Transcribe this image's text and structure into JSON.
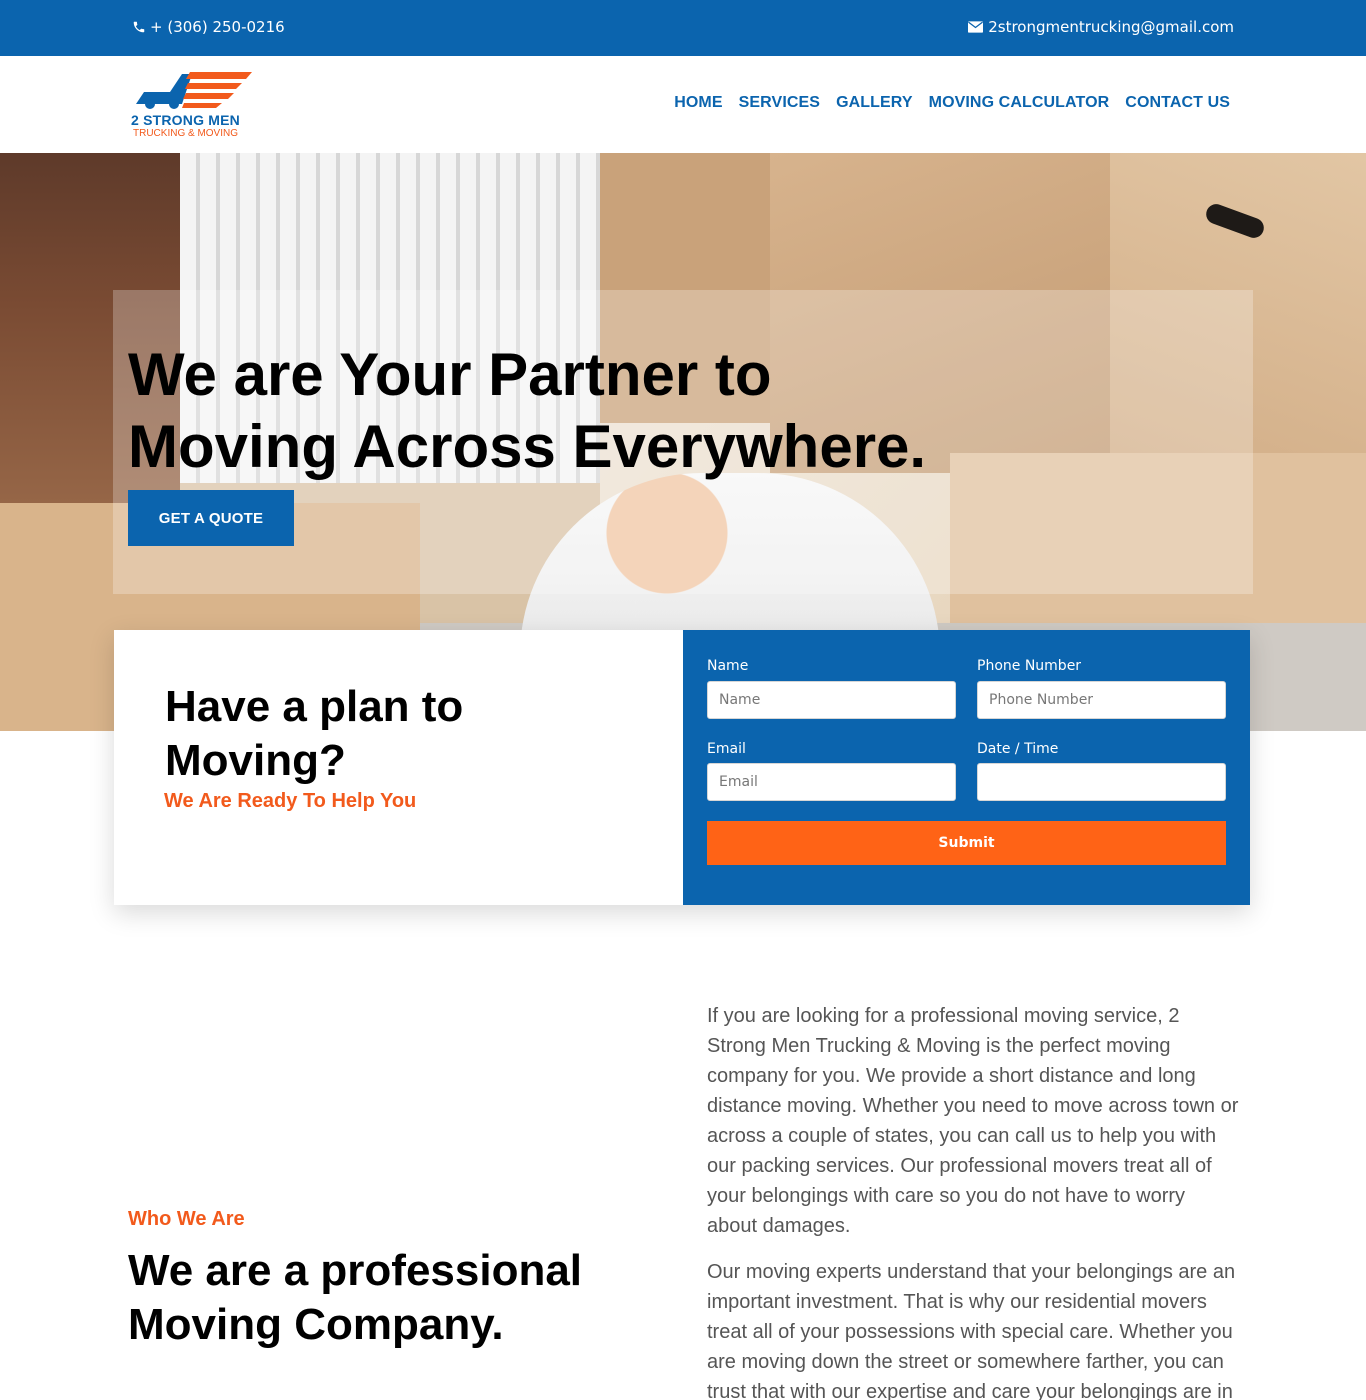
{
  "topbar": {
    "phone": "+ (306) 250-0216",
    "email": "2strongmentrucking@gmail.com"
  },
  "logo": {
    "line1": "2 STRONG MEN",
    "line2": "TRUCKING & MOVING"
  },
  "nav": [
    "HOME",
    "SERVICES",
    "GALLERY",
    "MOVING CALCULATOR",
    "CONTACT US"
  ],
  "hero": {
    "title_line1": "We are Your Partner to",
    "title_line2": "Moving Across Everywhere.",
    "cta": "GET A QUOTE"
  },
  "plan": {
    "title_line1": "Have a plan to",
    "title_line2": "Moving?",
    "subtitle": "We Are Ready To Help You"
  },
  "form": {
    "name_label": "Name",
    "name_placeholder": "Name",
    "phone_label": "Phone Number",
    "phone_placeholder": "Phone Number",
    "email_label": "Email",
    "email_placeholder": "Email",
    "date_label": "Date / Time",
    "date_value": "",
    "submit": "Submit"
  },
  "about": {
    "kicker": "Who We Are",
    "title_line1": "We are a professional",
    "title_line2": "Moving Company.",
    "paragraph1": "If you are looking for a professional moving service, 2 Strong Men Trucking & Moving is the perfect moving company for you. We provide a short distance and long distance moving. Whether you need to move across town or across a couple of states, you can call us to help you with our packing services. Our professional movers treat all of your belongings with care so you do not have to worry about damages.",
    "paragraph2": "Our moving experts understand that your belongings are an important investment. That is why our residential movers treat all of your possessions with special care. Whether you are moving down the street or somewhere farther, you can trust that with our expertise and care your belongings are in"
  },
  "colors": {
    "brand_blue": "#0b64ae",
    "accent_orange": "#f25a1c",
    "submit_orange": "#ff6316"
  }
}
